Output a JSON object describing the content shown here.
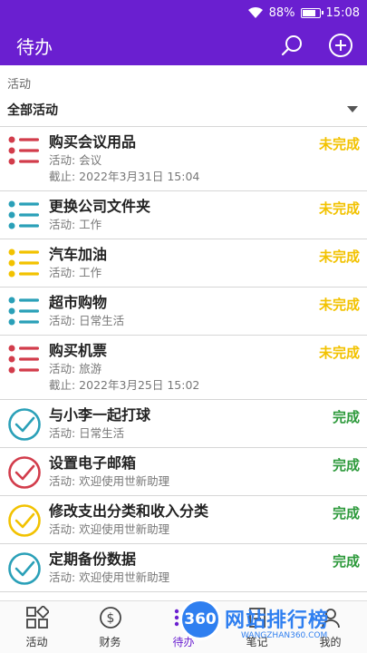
{
  "status": {
    "battery": "88%",
    "battery_level": 0.88,
    "time": "15:08"
  },
  "appbar": {
    "title": "待办"
  },
  "filter": {
    "label": "活动",
    "value": "全部活动"
  },
  "todos": [
    {
      "title": "购买会议用品",
      "activity": "活动: 会议",
      "due": "截止: 2022年3月31日 15:04",
      "status": "未完成",
      "icon": "list-icon",
      "color": "#d23c4b"
    },
    {
      "title": "更换公司文件夹",
      "activity": "活动: 工作",
      "status": "未完成",
      "icon": "list-icon",
      "color": "#2aa0b8"
    },
    {
      "title": "汽车加油",
      "activity": "活动: 工作",
      "status": "未完成",
      "icon": "list-icon",
      "color": "#f2c200"
    },
    {
      "title": "超市购物",
      "activity": "活动: 日常生活",
      "status": "未完成",
      "icon": "list-icon",
      "color": "#2aa0b8"
    },
    {
      "title": "购买机票",
      "activity": "活动: 旅游",
      "due": "截止: 2022年3月25日 15:02",
      "status": "未完成",
      "icon": "list-icon",
      "color": "#d23c4b"
    },
    {
      "title": "与小李一起打球",
      "activity": "活动: 日常生活",
      "status": "完成",
      "icon": "check-circle-icon",
      "color": "#2aa0b8"
    },
    {
      "title": "设置电子邮箱",
      "activity": "活动: 欢迎使用世新助理",
      "status": "完成",
      "icon": "check-circle-icon",
      "color": "#d23c4b"
    },
    {
      "title": "修改支出分类和收入分类",
      "activity": "活动: 欢迎使用世新助理",
      "status": "完成",
      "icon": "check-circle-icon",
      "color": "#f2c200"
    },
    {
      "title": "定期备份数据",
      "activity": "活动: 欢迎使用世新助理",
      "status": "完成",
      "icon": "check-circle-icon",
      "color": "#2aa0b8"
    }
  ],
  "nav": [
    {
      "label": "活动",
      "icon": "grid-icon"
    },
    {
      "label": "财务",
      "icon": "dollar-icon"
    },
    {
      "label": "待办",
      "icon": "todo-icon",
      "active": true
    },
    {
      "label": "笔记",
      "icon": "note-icon"
    },
    {
      "label": "我的",
      "icon": "user-icon"
    }
  ],
  "watermark": {
    "badge": "360",
    "text": "网站排行榜",
    "sub": "WANGZHAN360.COM"
  },
  "colors": {
    "accent": "#6a1fd0",
    "pending": "#f2c200",
    "done": "#2e9a3c"
  }
}
